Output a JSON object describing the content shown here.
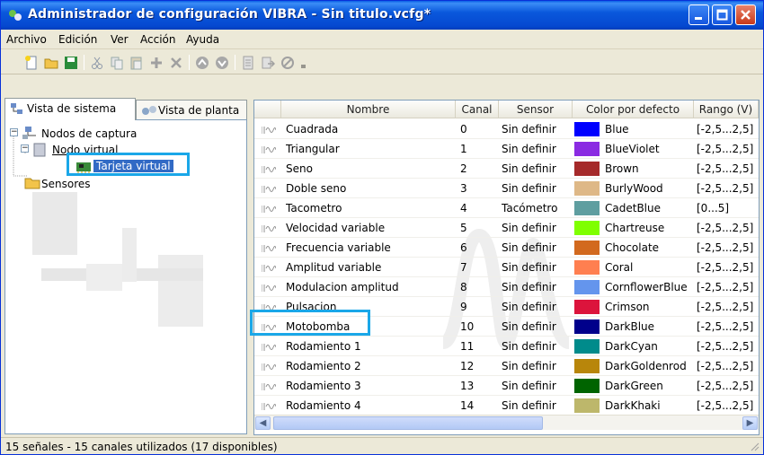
{
  "window": {
    "title": "Administrador de configuración VIBRA - Sin titulo.vcfg*",
    "buttons": {
      "minimize": "minimize-icon",
      "maximize": "maximize-icon",
      "close": "close-icon"
    }
  },
  "menu": [
    "Archivo",
    "Edición",
    "Ver",
    "Acción",
    "Ayuda"
  ],
  "toolbar_icons": [
    "new-icon",
    "open-icon",
    "save-icon",
    "cut-icon",
    "copy-icon",
    "paste-icon",
    "add-icon",
    "delete-icon",
    "move-up-icon",
    "move-down-icon",
    "properties-icon",
    "export-icon",
    "cancel-icon"
  ],
  "tabs": {
    "system": "Vista de sistema",
    "plant": "Vista de planta"
  },
  "tree": {
    "capture_nodes": "Nodos de captura",
    "virtual_node": "Nodo virtual",
    "virtual_card": "Tarjeta virtual",
    "sensors": "Sensores"
  },
  "columns": [
    "Nombre",
    "Canal",
    "Sensor",
    "Color por defecto",
    "Rango (V)"
  ],
  "rows": [
    {
      "name": "Cuadrada",
      "channel": "0",
      "sensor": "Sin definir",
      "color_name": "Blue",
      "color": "#0000ff",
      "range": "[-2,5...2,5]"
    },
    {
      "name": "Triangular",
      "channel": "1",
      "sensor": "Sin definir",
      "color_name": "BlueViolet",
      "color": "#8a2be2",
      "range": "[-2,5...2,5]"
    },
    {
      "name": "Seno",
      "channel": "2",
      "sensor": "Sin definir",
      "color_name": "Brown",
      "color": "#a52a2a",
      "range": "[-2,5...2,5]"
    },
    {
      "name": "Doble seno",
      "channel": "3",
      "sensor": "Sin definir",
      "color_name": "BurlyWood",
      "color": "#deb887",
      "range": "[-2,5...2,5]"
    },
    {
      "name": "Tacometro",
      "channel": "4",
      "sensor": "Tacómetro",
      "color_name": "CadetBlue",
      "color": "#5f9ea0",
      "range": "[0...5]"
    },
    {
      "name": "Velocidad variable",
      "channel": "5",
      "sensor": "Sin definir",
      "color_name": "Chartreuse",
      "color": "#7fff00",
      "range": "[-2,5...2,5]"
    },
    {
      "name": "Frecuencia variable",
      "channel": "6",
      "sensor": "Sin definir",
      "color_name": "Chocolate",
      "color": "#d2691e",
      "range": "[-2,5...2,5]"
    },
    {
      "name": "Amplitud variable",
      "channel": "7",
      "sensor": "Sin definir",
      "color_name": "Coral",
      "color": "#ff7f50",
      "range": "[-2,5...2,5]"
    },
    {
      "name": "Modulacion amplitud",
      "channel": "8",
      "sensor": "Sin definir",
      "color_name": "CornflowerBlue",
      "color": "#6495ed",
      "range": "[-2,5...2,5]"
    },
    {
      "name": "Pulsacion",
      "channel": "9",
      "sensor": "Sin definir",
      "color_name": "Crimson",
      "color": "#dc143c",
      "range": "[-2,5...2,5]"
    },
    {
      "name": "Motobomba",
      "channel": "10",
      "sensor": "Sin definir",
      "color_name": "DarkBlue",
      "color": "#00008b",
      "range": "[-2,5...2,5]"
    },
    {
      "name": "Rodamiento 1",
      "channel": "11",
      "sensor": "Sin definir",
      "color_name": "DarkCyan",
      "color": "#008b8b",
      "range": "[-2,5...2,5]"
    },
    {
      "name": "Rodamiento 2",
      "channel": "12",
      "sensor": "Sin definir",
      "color_name": "DarkGoldenrod",
      "color": "#b8860b",
      "range": "[-2,5...2,5]"
    },
    {
      "name": "Rodamiento 3",
      "channel": "13",
      "sensor": "Sin definir",
      "color_name": "DarkGreen",
      "color": "#006400",
      "range": "[-2,5...2,5]"
    },
    {
      "name": "Rodamiento 4",
      "channel": "14",
      "sensor": "Sin definir",
      "color_name": "DarkKhaki",
      "color": "#bdb76b",
      "range": "[-2,5...2,5]"
    }
  ],
  "status": "15 señales - 15 canales utilizados (17 disponibles)"
}
